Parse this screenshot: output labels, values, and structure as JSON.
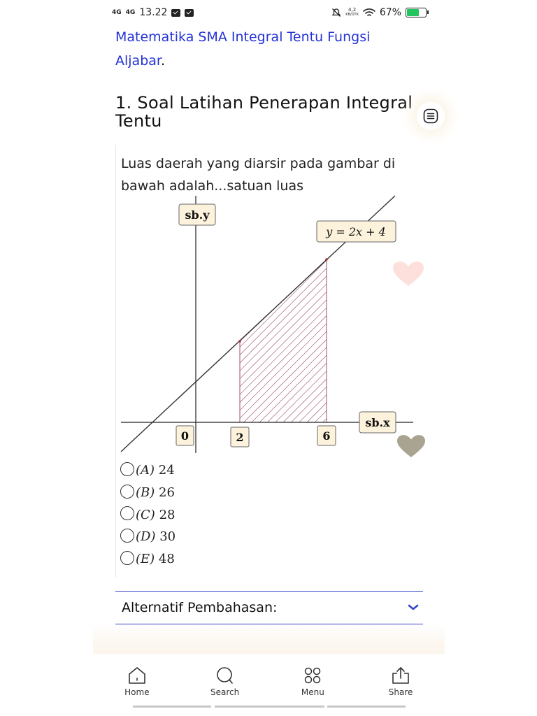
{
  "status": {
    "signal1": "4G",
    "signal2": "4G",
    "time": "13.22",
    "speed_value": "4,2",
    "speed_unit": "KB/DTK",
    "battery": "67%",
    "battery_fraction": 0.67
  },
  "article": {
    "link_text": "Matematika SMA Integral Tentu Fungsi Aljabar",
    "link_suffix": ".",
    "section_title": "1. Soal Latihan Penerapan Integral Tentu",
    "question": "Luas daerah yang diarsir pada gambar di bawah adalah...satuan luas"
  },
  "graph": {
    "y_axis_label": "sb.y",
    "x_axis_label": "sb.x",
    "equation": "y = 2x + 4",
    "ticks": [
      "0",
      "2",
      "6"
    ],
    "shaded_from": 2,
    "shaded_to": 6
  },
  "options": [
    {
      "letter": "(A)",
      "value": "24"
    },
    {
      "letter": "(B)",
      "value": "26"
    },
    {
      "letter": "(C)",
      "value": "28"
    },
    {
      "letter": "(D)",
      "value": "30"
    },
    {
      "letter": "(E)",
      "value": "48"
    }
  ],
  "accordion": {
    "title": "Alternatif Pembahasan:"
  },
  "nav": {
    "items": [
      {
        "label": "Home",
        "icon": "home-icon"
      },
      {
        "label": "Search",
        "icon": "search-icon"
      },
      {
        "label": "Menu",
        "icon": "menu-grid-icon"
      },
      {
        "label": "Share",
        "icon": "share-icon"
      }
    ]
  },
  "colors": {
    "link": "#2433d6",
    "accent": "#3443c8",
    "shade": "#8a2550",
    "label_bg": "#fdf3dc",
    "heart_pink": "#fde0dc",
    "heart_gray": "#a9a391",
    "battery": "#22c55e"
  }
}
